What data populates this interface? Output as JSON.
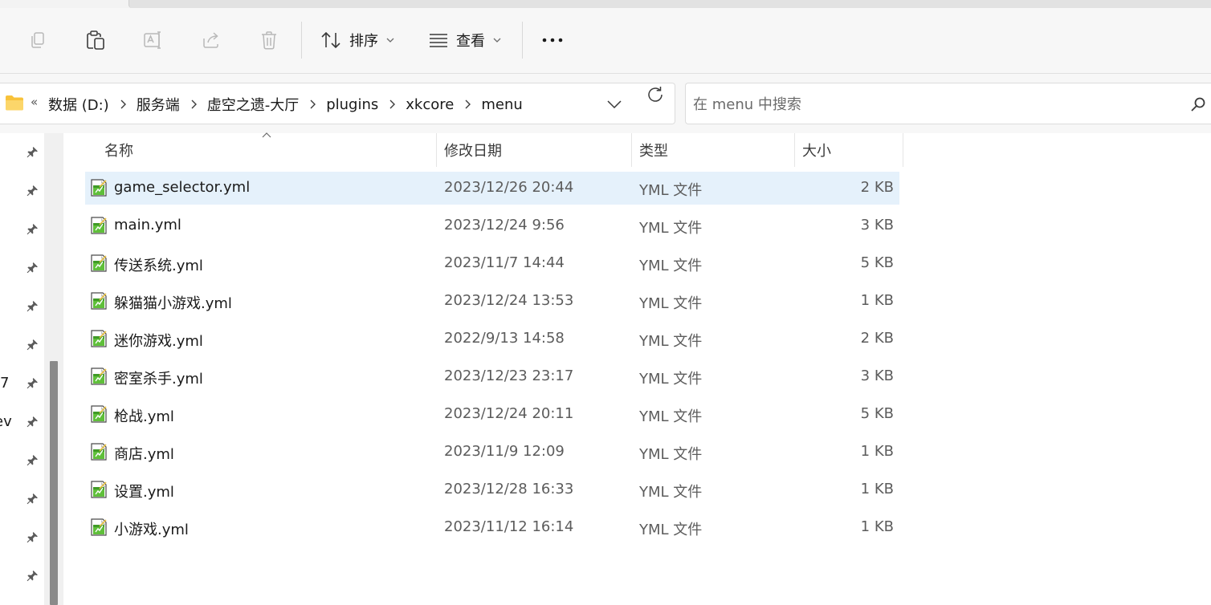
{
  "toolbar": {
    "sort_label": "排序",
    "view_label": "查看",
    "icons": [
      "copy-icon",
      "paste-icon",
      "rename-icon",
      "share-icon",
      "delete-icon",
      "sort-icon",
      "view-icon",
      "more-icon"
    ]
  },
  "address": {
    "overflow": "«",
    "breadcrumbs": [
      "数据 (D:)",
      "服务端",
      "虚空之遗-大厅",
      "plugins",
      "xkcore",
      "menu"
    ]
  },
  "search": {
    "placeholder": "在 menu 中搜索"
  },
  "nav": {
    "partial_items": [
      "7",
      "lev"
    ]
  },
  "columns": {
    "name": "名称",
    "date": "修改日期",
    "type": "类型",
    "size": "大小"
  },
  "files": [
    {
      "name": "game_selector.yml",
      "date": "2023/12/26 20:44",
      "type": "YML 文件",
      "size": "2 KB",
      "selected": true
    },
    {
      "name": "main.yml",
      "date": "2023/12/24 9:56",
      "type": "YML 文件",
      "size": "3 KB"
    },
    {
      "name": "传送系统.yml",
      "date": "2023/11/7 14:44",
      "type": "YML 文件",
      "size": "5 KB"
    },
    {
      "name": "躲猫猫小游戏.yml",
      "date": "2023/12/24 13:53",
      "type": "YML 文件",
      "size": "1 KB"
    },
    {
      "name": "迷你游戏.yml",
      "date": "2022/9/13 14:58",
      "type": "YML 文件",
      "size": "2 KB"
    },
    {
      "name": "密室杀手.yml",
      "date": "2023/12/23 23:17",
      "type": "YML 文件",
      "size": "3 KB"
    },
    {
      "name": "枪战.yml",
      "date": "2023/12/24 20:11",
      "type": "YML 文件",
      "size": "5 KB"
    },
    {
      "name": "商店.yml",
      "date": "2023/11/9 12:09",
      "type": "YML 文件",
      "size": "1 KB"
    },
    {
      "name": "设置.yml",
      "date": "2023/12/28 16:33",
      "type": "YML 文件",
      "size": "1 KB"
    },
    {
      "name": "小游戏.yml",
      "date": "2023/11/12 16:14",
      "type": "YML 文件",
      "size": "1 KB"
    }
  ],
  "colors": {
    "selection": "#e5f1fb",
    "folder": "#f8c23a"
  }
}
